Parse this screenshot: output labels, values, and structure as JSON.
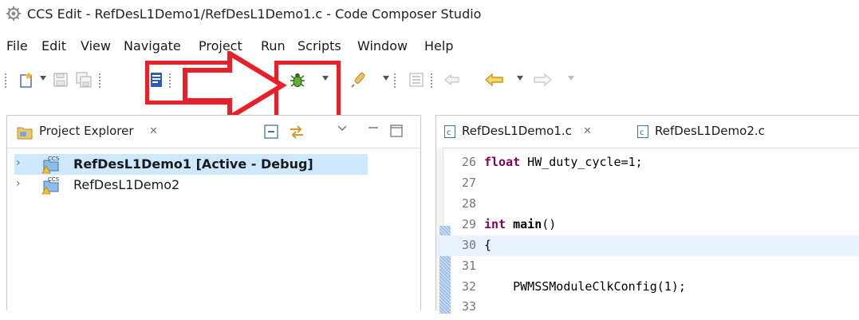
{
  "window": {
    "title": "CCS Edit - RefDesL1Demo1/RefDesL1Demo1.c - Code Composer Studio"
  },
  "menu": {
    "items": [
      "File",
      "Edit",
      "View",
      "Navigate",
      "Project",
      "Run",
      "Scripts",
      "Window",
      "Help"
    ]
  },
  "toolbar": {
    "buttons": [
      {
        "icon": "new-file-icon"
      },
      {
        "icon": "save-icon"
      },
      {
        "icon": "save-all-icon"
      },
      {
        "icon": "console-icon"
      },
      {
        "icon": "hammer-build-icon"
      },
      {
        "icon": "search-icon"
      },
      {
        "icon": "debug-bug-icon"
      },
      {
        "icon": "flash-tool-icon"
      },
      {
        "icon": "outline-icon"
      },
      {
        "icon": "back-icon"
      },
      {
        "icon": "navigate-back-arrow-icon"
      },
      {
        "icon": "navigate-forward-arrow-icon"
      }
    ],
    "highlight_color": "#e8202a"
  },
  "project_explorer": {
    "tab_label": "Project Explorer",
    "close_glyph": "✕",
    "projects": [
      {
        "name": "RefDesL1Demo1  [Active - Debug]",
        "selected": true,
        "bold": true
      },
      {
        "name": "RefDesL1Demo2",
        "selected": false,
        "bold": false
      }
    ]
  },
  "editor": {
    "tabs": [
      {
        "label": "RefDesL1Demo1.c",
        "active": true,
        "close_glyph": "✕"
      },
      {
        "label": "RefDesL1Demo2.c",
        "active": false
      }
    ],
    "lines": [
      {
        "num": "26",
        "kw": "float",
        "rest": " HW_duty_cycle=1;"
      },
      {
        "num": "27",
        "kw": "",
        "rest": ""
      },
      {
        "num": "28",
        "kw": "",
        "rest": ""
      },
      {
        "num": "29",
        "kw": "int",
        "kw2": "main",
        "rest": "()"
      },
      {
        "num": "30",
        "kw": "",
        "rest": "{",
        "current": true
      },
      {
        "num": "31",
        "kw": "",
        "rest": ""
      },
      {
        "num": "32",
        "kw": "",
        "rest": "    PWMSSModuleClkConfig(1);"
      }
    ]
  }
}
